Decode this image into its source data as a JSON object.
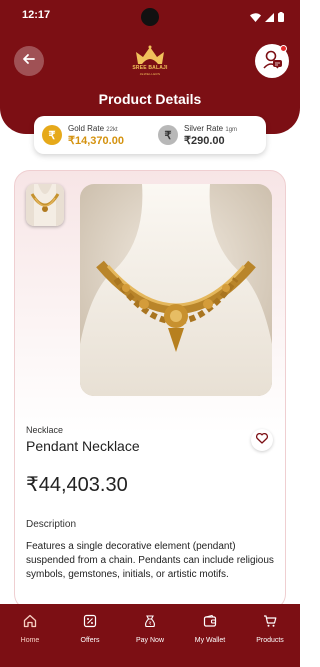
{
  "status_bar": {
    "time": "12:17"
  },
  "brand": {
    "name": "SREE BALAJI",
    "subtitle": "JEWELLERS"
  },
  "page": {
    "title": "Product Details"
  },
  "rates": {
    "gold": {
      "label": "Gold Rate",
      "unit": "22kt",
      "value": "₹14,370.00"
    },
    "silver": {
      "label": "Silver Rate",
      "unit": "1gm",
      "value": "₹290.00"
    }
  },
  "product": {
    "category": "Necklace",
    "name": "Pendant Necklace",
    "price": "₹44,403.30",
    "description_title": "Description",
    "description": "Features a single decorative element (pendant) suspended from a chain. Pendants can include religious symbols, gemstones, initials, or artistic motifs."
  },
  "bottom_nav": {
    "items": [
      {
        "label": "Home",
        "icon": "home-icon",
        "active": true
      },
      {
        "label": "Offers",
        "icon": "offers-icon",
        "active": false
      },
      {
        "label": "Pay Now",
        "icon": "pay-now-icon",
        "active": false
      },
      {
        "label": "My Wallet",
        "icon": "wallet-icon",
        "active": false
      },
      {
        "label": "Products",
        "icon": "products-icon",
        "active": false
      }
    ]
  },
  "colors": {
    "primary": "#7c0f14",
    "gold": "#d4920f",
    "panel": "#f7e5e6"
  }
}
